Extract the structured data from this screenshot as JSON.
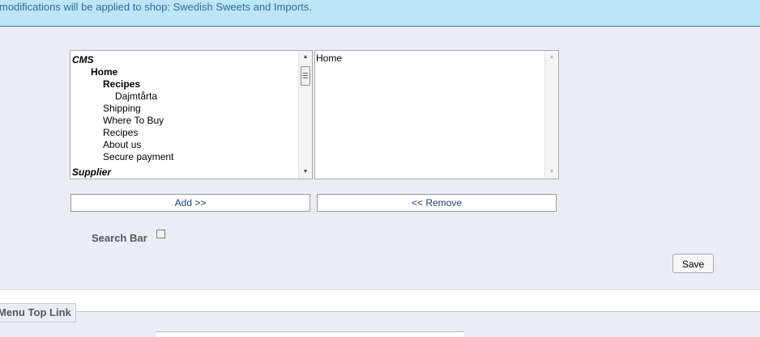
{
  "banner": {
    "text": "modifications will be applied to shop: Swedish Sweets and Imports."
  },
  "available_list": {
    "items": [
      {
        "label": "CMS",
        "style": "group"
      },
      {
        "label": "Home",
        "style": "bold"
      },
      {
        "label": "Recipes",
        "style": "bold"
      },
      {
        "label": "Dajmtårta",
        "style": "normal"
      },
      {
        "label": "Shipping",
        "style": "normal"
      },
      {
        "label": "Where To Buy",
        "style": "normal"
      },
      {
        "label": "Recipes",
        "style": "normal"
      },
      {
        "label": "About us",
        "style": "normal"
      },
      {
        "label": "Secure payment",
        "style": "normal"
      },
      {
        "label": "Supplier",
        "style": "group"
      }
    ]
  },
  "selected_list": {
    "items": [
      {
        "label": "Home"
      }
    ]
  },
  "buttons": {
    "add": "Add >>",
    "remove": "<< Remove",
    "save": "Save"
  },
  "search_bar": {
    "label": "Search Bar",
    "checked": false
  },
  "section": {
    "legend": "Menu Top Link"
  },
  "icons": {
    "up": "scroll-up-arrow",
    "down": "scroll-down-arrow"
  }
}
